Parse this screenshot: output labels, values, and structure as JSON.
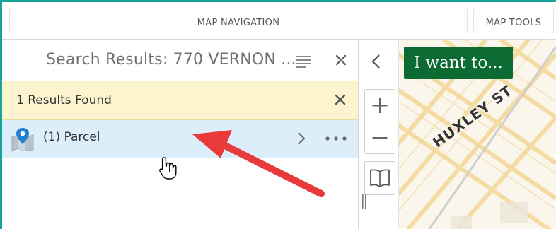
{
  "tabs": {
    "nav_label": "MAP NAVIGATION",
    "tools_label": "MAP TOOLS"
  },
  "search_panel": {
    "title": "Search Results: 770 VERNON ...",
    "results_count_text": "1 Results Found",
    "result_item_label": "(1) Parcel"
  },
  "map": {
    "want_button_label": "I want to...",
    "street_label": "HUXLEY ST"
  },
  "icons": {
    "list": "list-icon",
    "close": "close-icon",
    "map_marker": "map-marker-icon",
    "chevron_right": "chevron-right-icon",
    "more": "more-icon",
    "chevron_left": "chevron-left-icon",
    "zoom_in": "plus-icon",
    "zoom_out": "minus-icon",
    "book": "book-icon",
    "cursor": "hand-cursor-icon",
    "arrow": "arrow-annotation"
  },
  "colors": {
    "accent_teal": "#1aa39a",
    "results_bar": "#fbf4cf",
    "selected_row": "#dceefa",
    "want_button": "#0b6b32",
    "annotation_red": "#e8393b"
  }
}
